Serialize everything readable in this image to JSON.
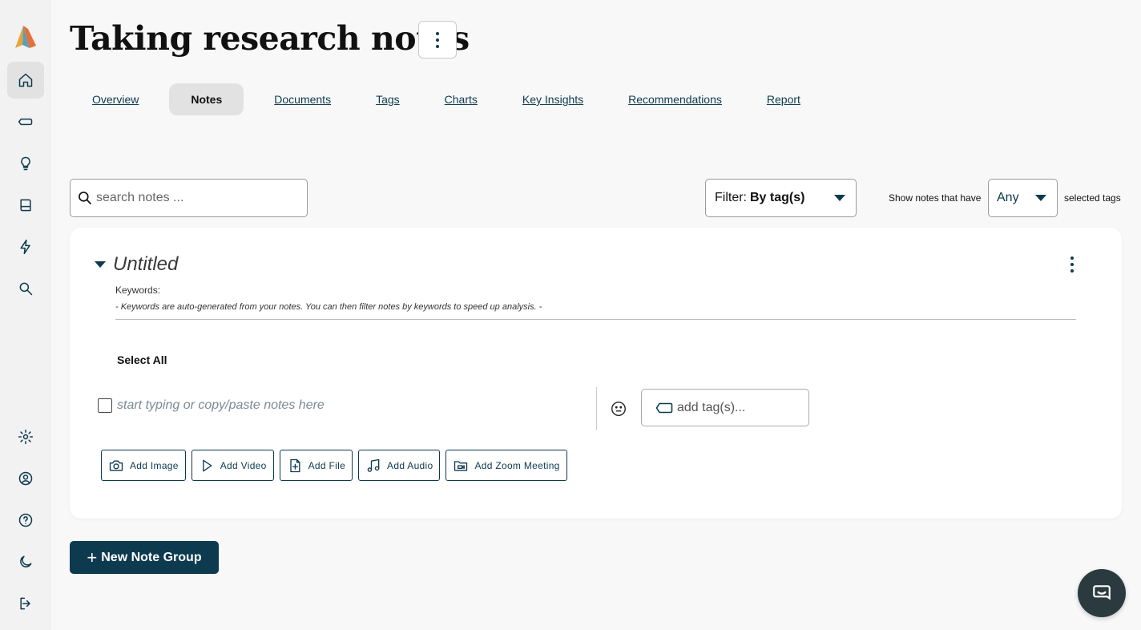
{
  "page": {
    "title": "Taking research notes"
  },
  "tabs": [
    {
      "label": "Overview"
    },
    {
      "label": "Notes",
      "active": true
    },
    {
      "label": "Documents"
    },
    {
      "label": "Tags"
    },
    {
      "label": "Charts"
    },
    {
      "label": "Key Insights"
    },
    {
      "label": "Recommendations"
    },
    {
      "label": "Report"
    }
  ],
  "sidebar": {
    "top_icons": [
      "home-icon",
      "tag-icon",
      "lightbulb-icon",
      "book-icon",
      "lightning-icon",
      "search-icon"
    ],
    "bottom_icons": [
      "settings-icon",
      "account-icon",
      "help-icon",
      "dark-mode-icon",
      "logout-icon"
    ]
  },
  "search": {
    "placeholder": "search notes ..."
  },
  "filter": {
    "prefix": "Filter:",
    "value": "By tag(s)"
  },
  "tag_match": {
    "label_before": "Show notes that have",
    "value": "Any",
    "label_after": "selected tags"
  },
  "note_group": {
    "title": "Untitled",
    "keywords_label": "Keywords:",
    "keywords_hint": "- Keywords are auto-generated from your notes. You can then filter notes by keywords to speed up analysis. -",
    "select_all": "Select All",
    "note_placeholder": "start typing or copy/paste notes here",
    "tag_placeholder": "add tag(s)...",
    "add_buttons": [
      {
        "label": "Add Image",
        "icon": "camera-icon"
      },
      {
        "label": "Add Video",
        "icon": "play-icon"
      },
      {
        "label": "Add File",
        "icon": "file-plus-icon"
      },
      {
        "label": "Add Audio",
        "icon": "music-note-icon"
      },
      {
        "label": "Add Zoom Meeting",
        "icon": "video-folder-icon"
      }
    ]
  },
  "new_group_button": {
    "label": "New Note Group"
  },
  "colors": {
    "primary": "#0d3a4f",
    "background": "#f8f8f8",
    "sidebar": "#f2f2f2",
    "chat_fab": "#2b3a3f"
  }
}
